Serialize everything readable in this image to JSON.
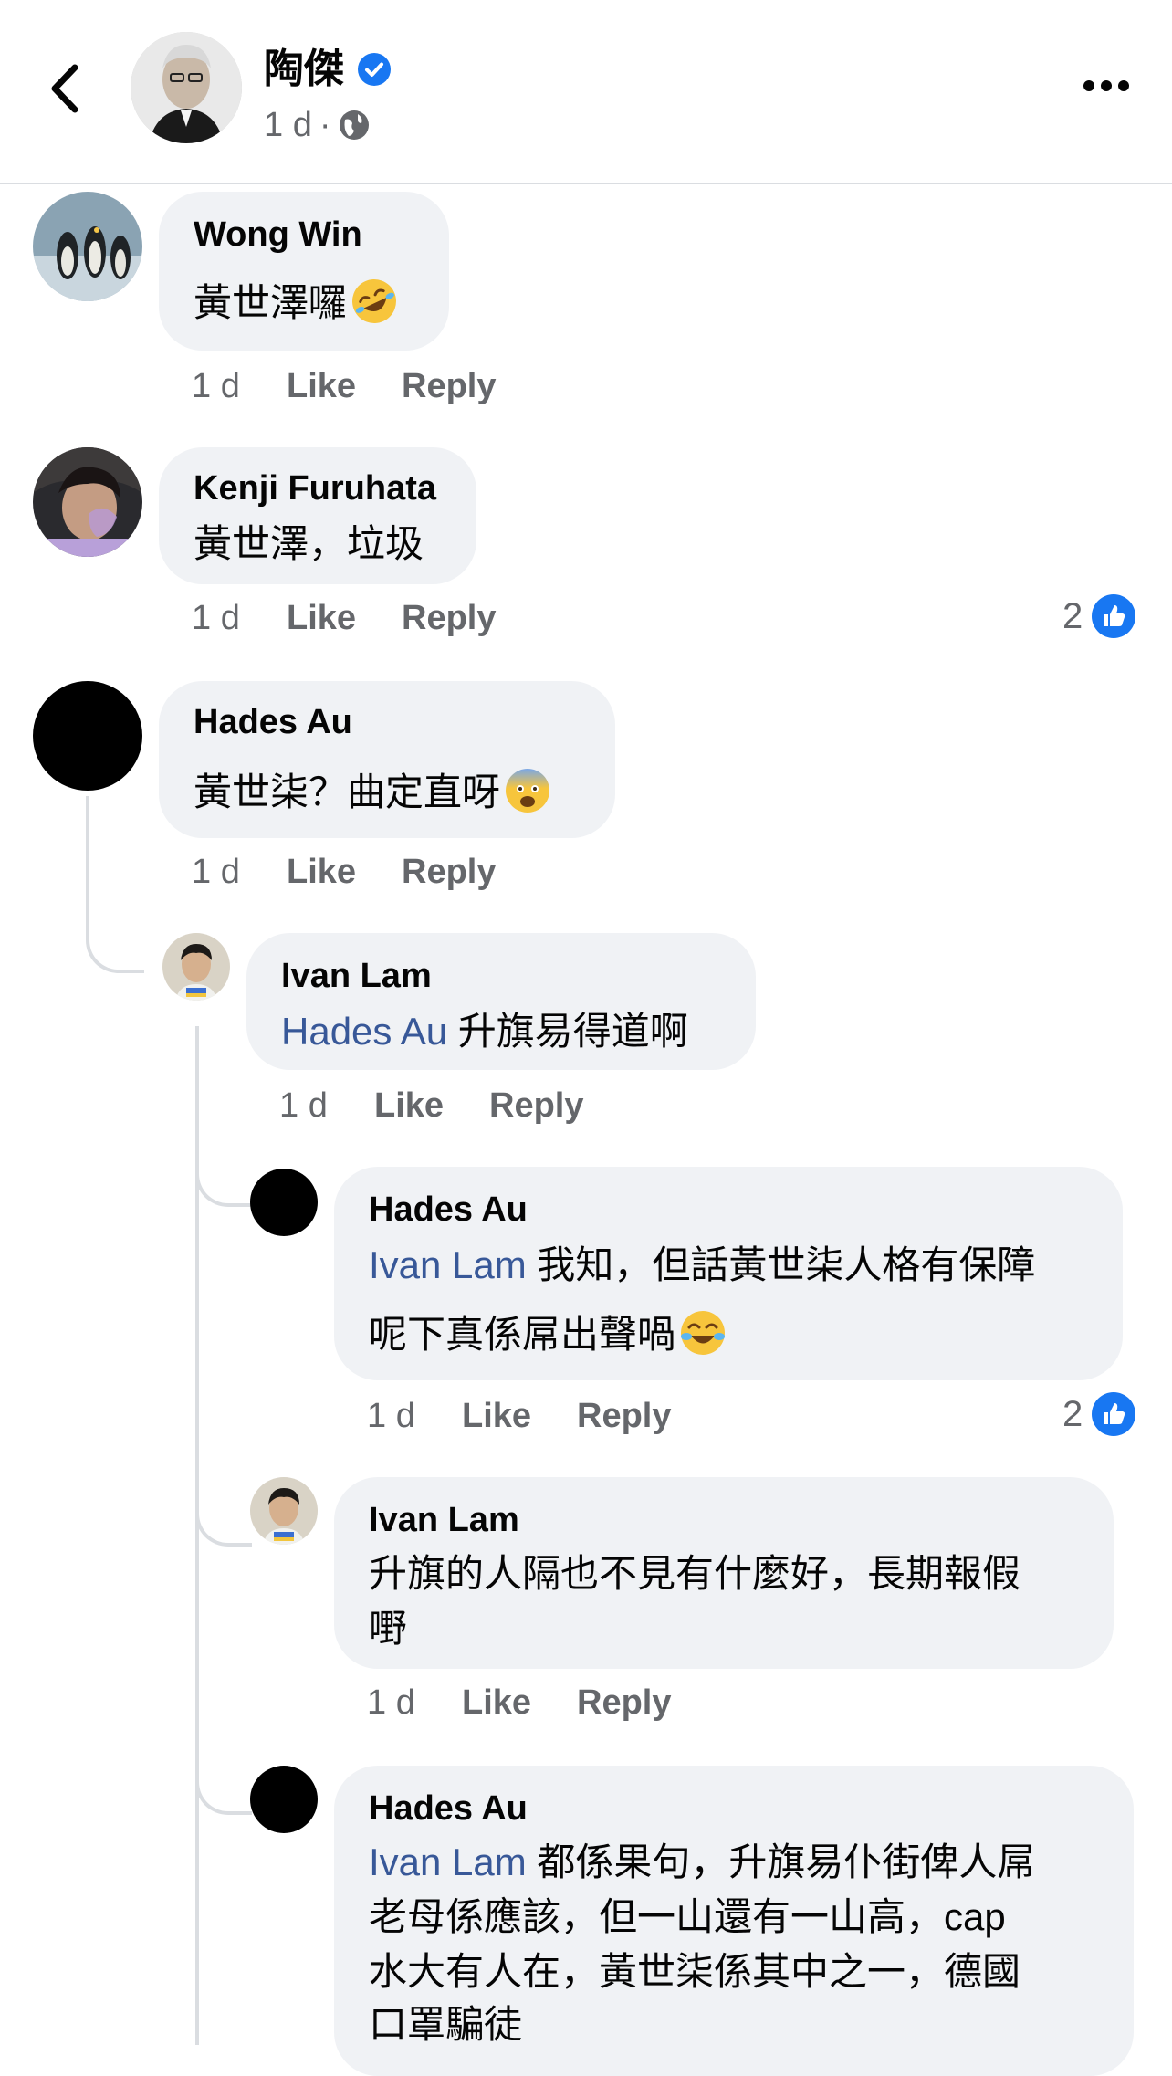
{
  "header": {
    "name": "陶傑",
    "time": "1 d",
    "separator": "·"
  },
  "comments": [
    {
      "author": "Wong Win",
      "text": "黃世澤囉",
      "emoji": "rolling-on-floor-laughing",
      "time": "1 d",
      "like_label": "Like",
      "reply_label": "Reply"
    },
    {
      "author": "Kenji Furuhata",
      "text": "黃世澤，垃圾",
      "time": "1 d",
      "like_label": "Like",
      "reply_label": "Reply",
      "reaction_count": "2"
    },
    {
      "author": "Hades Au",
      "text": "黃世柒？曲定直呀",
      "emoji": "fearful-face",
      "time": "1 d",
      "like_label": "Like",
      "reply_label": "Reply"
    }
  ],
  "replies": [
    {
      "author": "Ivan Lam",
      "mention": "Hades Au",
      "text": " 升旗易得道啊",
      "time": "1 d",
      "like_label": "Like",
      "reply_label": "Reply"
    },
    {
      "author": "Hades Au",
      "mention": "Ivan Lam",
      "text_line1": " 我知，但話黃世柒人格有保障",
      "text_line2": "呢下真係屌出聲喎",
      "emoji": "face-with-tears-of-joy",
      "time": "1 d",
      "like_label": "Like",
      "reply_label": "Reply",
      "reaction_count": "2"
    },
    {
      "author": "Ivan Lam",
      "text_line1": "升旗的人隔也不見有什麼好，長期報假",
      "text_line2": "嘢",
      "time": "1 d",
      "like_label": "Like",
      "reply_label": "Reply"
    },
    {
      "author": "Hades Au",
      "mention": "Ivan Lam",
      "text_line1": " 都係果句，升旗易仆街俾人屌",
      "text_line2": "老母係應該，但一山還有一山高，cap",
      "text_line3": "水大有人在，黃世柒係其中之一，德國",
      "text_line4": "口罩騙徒"
    }
  ]
}
